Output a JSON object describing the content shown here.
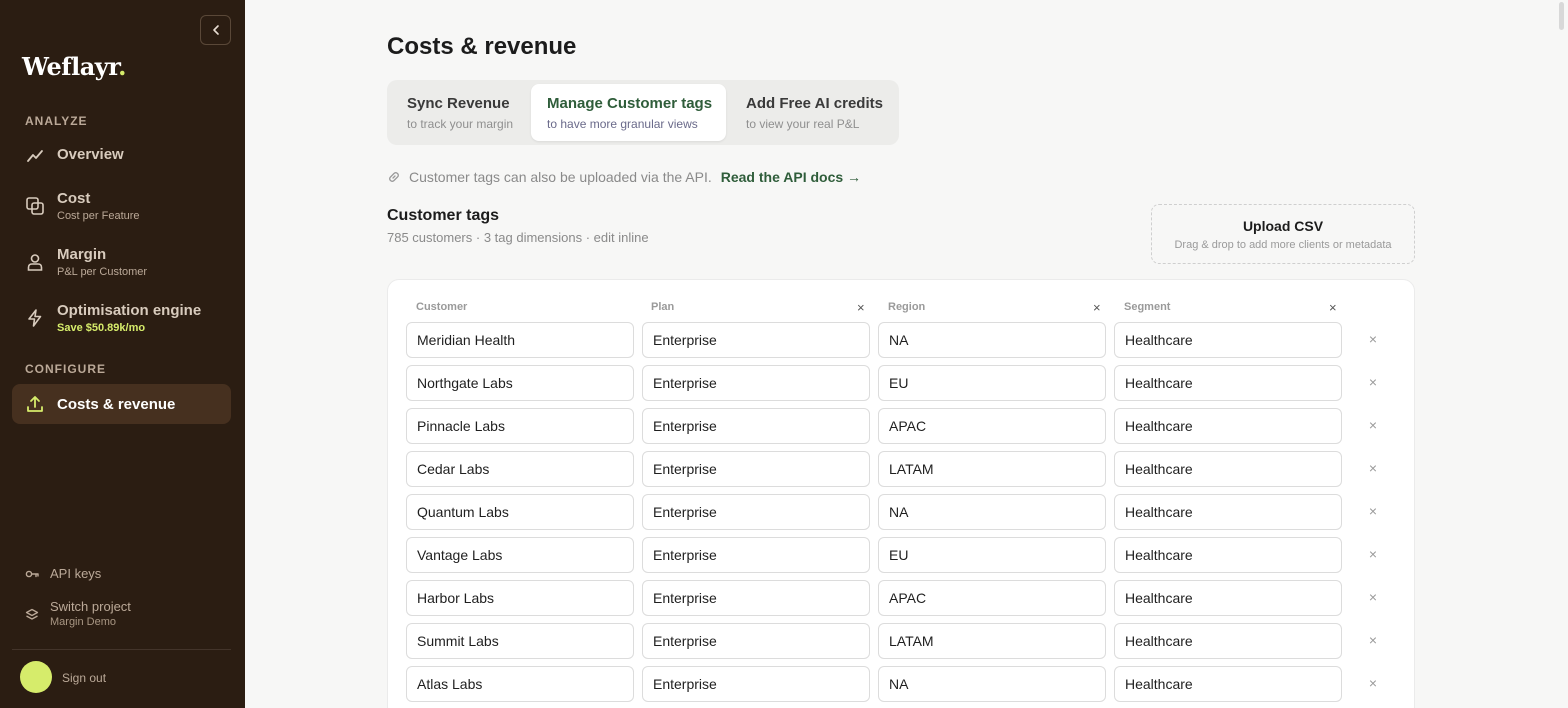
{
  "sidebar": {
    "logo": "Weflayr",
    "logo_dot": ".",
    "analyze_label": "ANALYZE",
    "configure_label": "CONFIGURE",
    "nav": [
      {
        "title": "Overview",
        "sub": "",
        "icon": "trend-line-icon"
      },
      {
        "title": "Cost",
        "sub": "Cost per Feature",
        "icon": "layers-icon"
      },
      {
        "title": "Margin",
        "sub": "P&L per Customer",
        "icon": "user-icon"
      },
      {
        "title": "Optimisation engine",
        "sub": "Save $50.89k/mo",
        "icon": "lightning-icon"
      }
    ],
    "configure_item": {
      "title": "Costs & revenue",
      "icon": "upload-icon"
    },
    "footer": {
      "api_keys": "API keys",
      "switch_project": "Switch project",
      "project_name": "Margin Demo",
      "sign_out": "Sign out"
    }
  },
  "main": {
    "title": "Costs & revenue",
    "tabs": [
      {
        "title": "Sync Revenue",
        "sub": "to track your margin"
      },
      {
        "title": "Manage Customer tags",
        "sub": "to have more granular views"
      },
      {
        "title": "Add Free AI credits",
        "sub": "to view your real P&L"
      }
    ],
    "api_note": "Customer tags can also be uploaded via the API.",
    "api_link": "Read the API docs →",
    "section_title": "Customer tags",
    "section_sub": "785 customers · 3 tag dimensions · edit inline",
    "upload": {
      "title": "Upload CSV",
      "sub": "Drag & drop to add more clients or metadata"
    },
    "table": {
      "columns": [
        "Customer",
        "Plan",
        "Region",
        "Segment"
      ],
      "rows": [
        [
          "Meridian Health",
          "Enterprise",
          "NA",
          "Healthcare"
        ],
        [
          "Northgate Labs",
          "Enterprise",
          "EU",
          "Healthcare"
        ],
        [
          "Pinnacle Labs",
          "Enterprise",
          "APAC",
          "Healthcare"
        ],
        [
          "Cedar Labs",
          "Enterprise",
          "LATAM",
          "Healthcare"
        ],
        [
          "Quantum Labs",
          "Enterprise",
          "NA",
          "Healthcare"
        ],
        [
          "Vantage Labs",
          "Enterprise",
          "EU",
          "Healthcare"
        ],
        [
          "Harbor Labs",
          "Enterprise",
          "APAC",
          "Healthcare"
        ],
        [
          "Summit Labs",
          "Enterprise",
          "LATAM",
          "Healthcare"
        ],
        [
          "Atlas Labs",
          "Enterprise",
          "NA",
          "Healthcare"
        ]
      ]
    }
  },
  "colors": {
    "sidebar_bg": "#2b1d12",
    "accent": "#d6ec6b",
    "link": "#2f5d3a"
  }
}
